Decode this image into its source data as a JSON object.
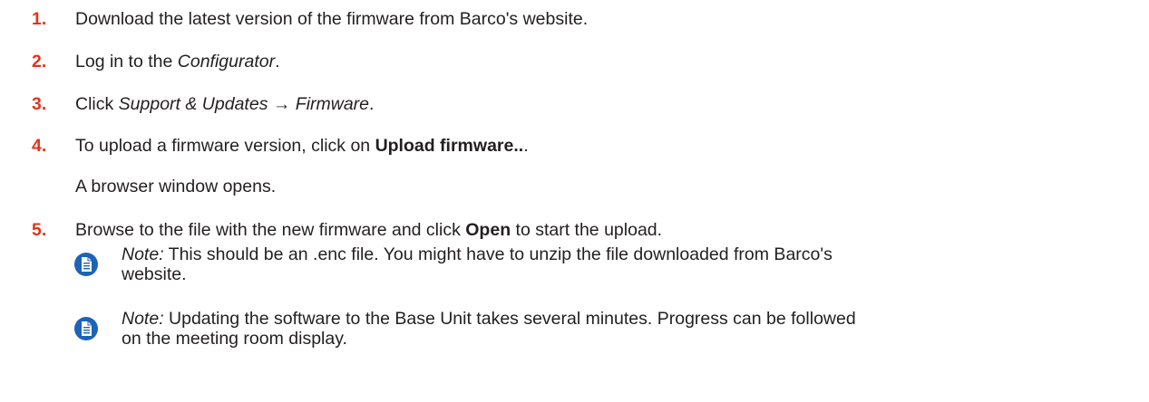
{
  "steps": [
    {
      "number": "1.",
      "text": "Download the latest version of the firmware from Barco's website."
    },
    {
      "number": "2.",
      "prefix": "Log in to the ",
      "italic": "Configurator",
      "suffix": "."
    },
    {
      "number": "3.",
      "prefix": "Click ",
      "italic": "Support & Updates → Firmware",
      "suffix": "."
    },
    {
      "number": "4.",
      "prefix": "To upload a firmware version, click on ",
      "bold": "Upload firmware..",
      "suffix": ".",
      "result": "A browser window opens."
    },
    {
      "number": "5.",
      "prefix": "Browse to the file with the new firmware and click ",
      "bold": "Open",
      "suffix": " to start the upload."
    }
  ],
  "notes": [
    {
      "icon": "note-icon",
      "label": "Note:",
      "line1": " This should be an .enc file. You might have to unzip the file downloaded from Barco's",
      "line2": "website."
    },
    {
      "icon": "note-icon",
      "label": "Note:",
      "line1": " Updating the software to the Base Unit takes several minutes. Progress can be followed",
      "line2": "on the meeting room display."
    }
  ],
  "colors": {
    "step_number": "#e5331b",
    "note_icon": "#1d63b6",
    "text": "#231f20"
  }
}
